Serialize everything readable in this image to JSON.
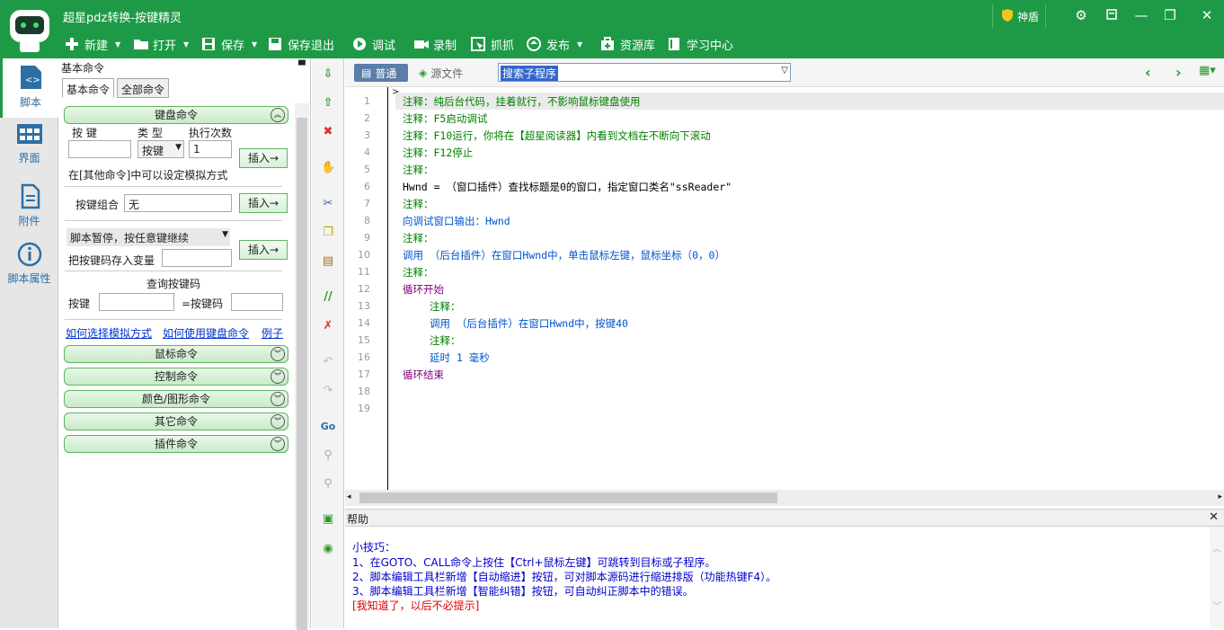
{
  "app_title": "超星pdz转换-按键精灵",
  "toolbar": [
    {
      "label": "新建",
      "icon": "plus-icon",
      "caret": true
    },
    {
      "label": "打开",
      "icon": "folder-icon",
      "caret": true
    },
    {
      "label": "保存",
      "icon": "save-icon",
      "caret": true
    },
    {
      "label": "保存退出",
      "icon": "save-exit-icon",
      "caret": false
    },
    {
      "label": "调试",
      "icon": "play-icon",
      "caret": false
    },
    {
      "label": "录制",
      "icon": "camera-icon",
      "caret": false
    },
    {
      "label": "抓抓",
      "icon": "grab-icon",
      "caret": false
    },
    {
      "label": "发布",
      "icon": "publish-icon",
      "caret": true
    },
    {
      "label": "资源库",
      "icon": "resource-icon",
      "caret": false
    },
    {
      "label": "学习中心",
      "icon": "book-icon",
      "caret": false
    }
  ],
  "shield_label": "神盾",
  "window_buttons": [
    "settings-icon",
    "skin-icon",
    "minimize-icon",
    "maximize-icon",
    "close-icon"
  ],
  "left_nav": [
    {
      "label": "脚本",
      "icon": "script-icon"
    },
    {
      "label": "界面",
      "icon": "ui-icon"
    },
    {
      "label": "附件",
      "icon": "attachment-icon"
    },
    {
      "label": "脚本属性",
      "icon": "info-icon"
    }
  ],
  "panel": {
    "title": "基本命令",
    "tabs": [
      "基本命令",
      "全部命令"
    ],
    "keyboard": {
      "header": "键盘命令",
      "col_key": "按 键",
      "col_type": "类 型",
      "col_count": "执行次数",
      "type_value": "按键",
      "count_value": "1",
      "insert": "插入→",
      "note": "在[其他命令]中可以设定模拟方式",
      "combo_label": "按键组合",
      "combo_value": "无",
      "pause_value": "脚本暂停，按任意键继续",
      "save_var_label": "把按键码存入变量",
      "query_title": "查询按键码",
      "query_key": "按键",
      "query_code": "=按键码"
    },
    "links": [
      "如何选择模拟方式",
      "如何使用键盘命令",
      "例子"
    ],
    "sections": [
      "鼠标命令",
      "控制命令",
      "颜色/图形命令",
      "其它命令",
      "插件命令"
    ]
  },
  "editor": {
    "tab_normal": "普通",
    "tab_source": "源文件",
    "search_value": "搜索子程序",
    "lines": [
      {
        "n": "1",
        "indent": 0,
        "cls": "green",
        "text": "注释：纯后台代码，挂着就行，不影响鼠标键盘使用"
      },
      {
        "n": "2",
        "indent": 0,
        "cls": "green",
        "text": "注释：F5启动调试"
      },
      {
        "n": "3",
        "indent": 0,
        "cls": "green",
        "text": "注释：F10运行，你将在【超星阅读器】内看到文档在不断向下滚动"
      },
      {
        "n": "4",
        "indent": 0,
        "cls": "green",
        "text": "注释：F12停止"
      },
      {
        "n": "5",
        "indent": 0,
        "cls": "green",
        "text": "注释："
      },
      {
        "n": "6",
        "indent": 0,
        "cls": "black",
        "text": "Hwnd = （窗口插件）查找标题是0的窗口，指定窗口类名\"ssReader\""
      },
      {
        "n": "7",
        "indent": 0,
        "cls": "green",
        "text": "注释："
      },
      {
        "n": "8",
        "indent": 0,
        "cls": "blue",
        "text": "向调试窗口输出：Hwnd"
      },
      {
        "n": "9",
        "indent": 0,
        "cls": "green",
        "text": "注释："
      },
      {
        "n": "10",
        "indent": 0,
        "cls": "blue",
        "text": "调用 （后台插件）在窗口Hwnd中，单击鼠标左键，鼠标坐标（0，0）"
      },
      {
        "n": "11",
        "indent": 0,
        "cls": "green",
        "text": "注释："
      },
      {
        "n": "12",
        "indent": 0,
        "cls": "purple",
        "text": "循环开始"
      },
      {
        "n": "13",
        "indent": 1,
        "cls": "green",
        "text": "注释："
      },
      {
        "n": "14",
        "indent": 1,
        "cls": "blue",
        "text": "调用 （后台插件）在窗口Hwnd中，按键40"
      },
      {
        "n": "15",
        "indent": 1,
        "cls": "green",
        "text": "注释："
      },
      {
        "n": "16",
        "indent": 1,
        "cls": "blue",
        "text": "延时 1 毫秒"
      },
      {
        "n": "17",
        "indent": 0,
        "cls": "purple",
        "text": "循环结束"
      }
    ],
    "line_numbers": [
      "1",
      "2",
      "3",
      "4",
      "5",
      "6",
      "7",
      "8",
      "9",
      "10",
      "11",
      "12",
      "13",
      "14",
      "15",
      "16",
      "17",
      "18",
      "19"
    ]
  },
  "help": {
    "title": "帮助",
    "tip_title": "小技巧：",
    "tips": [
      "1、在GOTO、CALL命令上按住【Ctrl+鼠标左键】可跳转到目标或子程序。",
      "2、脚本编辑工具栏新增【自动缩进】按钮，可对脚本源码进行缩进排版（功能热键F4）。",
      "3、脚本编辑工具栏新增【智能纠错】按钮，可自动纠正脚本中的错误。"
    ],
    "dismiss": "[我知道了，以后不必提示]"
  },
  "vertical_tools": [
    "arrow-down-icon",
    "arrow-up-icon",
    "delete-icon",
    "hand-icon",
    "cut-icon",
    "copy-icon",
    "paste-icon",
    "comment-icon",
    "uncomment-icon",
    "undo-icon",
    "redo-icon",
    "goto-icon",
    "find-icon",
    "find-next-icon",
    "panel-icon",
    "view-icon"
  ]
}
